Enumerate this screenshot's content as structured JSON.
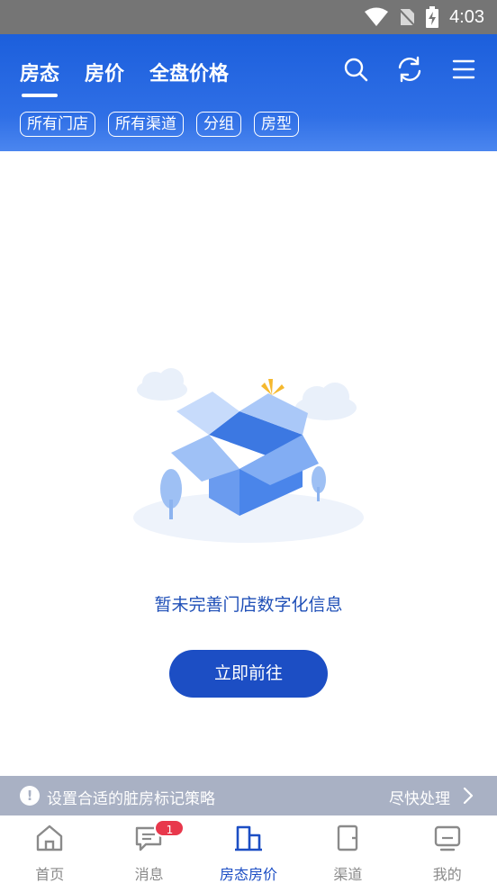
{
  "status_bar": {
    "time": "4:03",
    "icons": [
      "wifi-icon",
      "no-sim-icon",
      "battery-charging-icon"
    ]
  },
  "header": {
    "tabs": [
      {
        "label": "房态",
        "active": true
      },
      {
        "label": "房价",
        "active": false
      },
      {
        "label": "全盘价格",
        "active": false
      }
    ],
    "actions": [
      "search-icon",
      "refresh-icon",
      "menu-icon"
    ],
    "filters": [
      "所有门店",
      "所有渠道",
      "分组",
      "房型"
    ]
  },
  "empty_state": {
    "illustration": "empty-box-illustration",
    "message": "暂未完善门店数字化信息",
    "button_label": "立即前往"
  },
  "notice": {
    "icon": "info-icon",
    "message": "设置合适的脏房标记策略",
    "action_label": "尽快处理"
  },
  "bottom_nav": {
    "items": [
      {
        "label": "首页",
        "icon": "home-icon",
        "active": false
      },
      {
        "label": "消息",
        "icon": "message-icon",
        "active": false,
        "badge": "1"
      },
      {
        "label": "房态房价",
        "icon": "room-status-icon",
        "active": true
      },
      {
        "label": "渠道",
        "icon": "channel-icon",
        "active": false
      },
      {
        "label": "我的",
        "icon": "profile-icon",
        "active": false
      }
    ]
  },
  "colors": {
    "primary": "#1c4ec4",
    "header_blue": "#2f6fe6",
    "badge_red": "#e8384c",
    "notice_bg": "#a9b1c4"
  }
}
